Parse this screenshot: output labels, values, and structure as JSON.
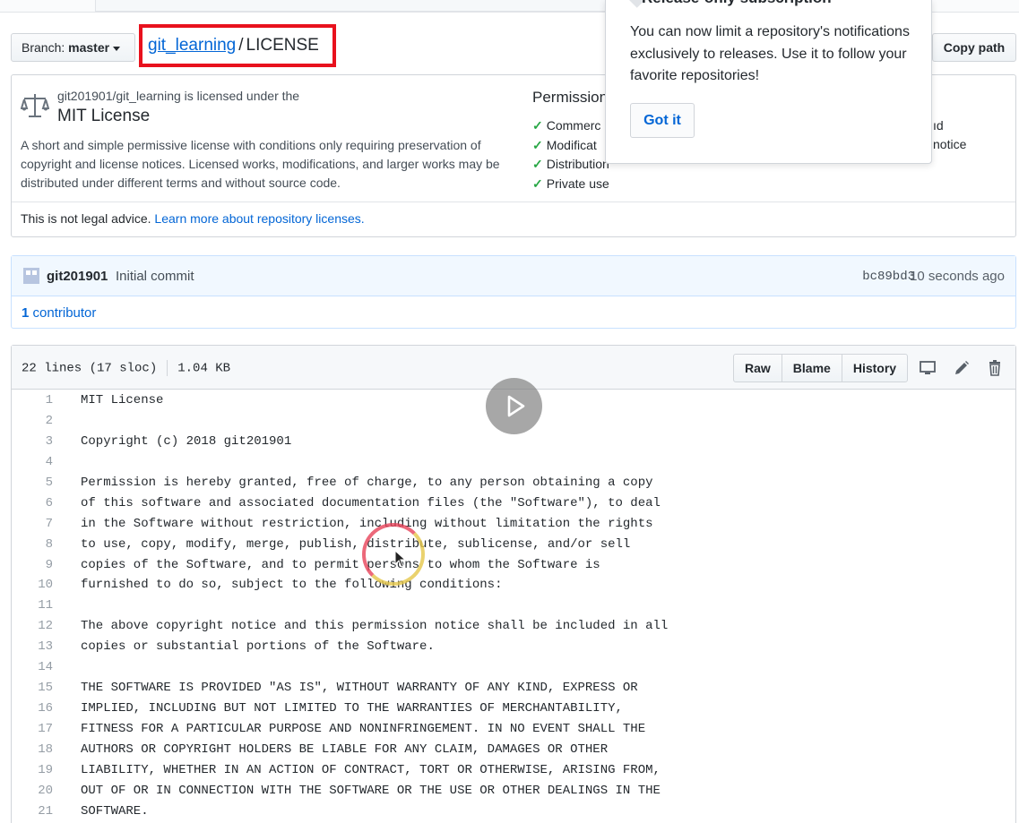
{
  "popover": {
    "title": "Release-only subscription",
    "body": "You can now limit a repository's notifications exclusively to releases. Use it to follow your favorite repositories!",
    "button": "Got it"
  },
  "branch": {
    "label": "Branch:",
    "value": "master"
  },
  "breadcrumb": {
    "repo": "git_learning",
    "separator": "/",
    "file": "LICENSE"
  },
  "copy_path": "Copy path",
  "license": {
    "owner_text": "git201901/git_learning is licensed under the",
    "name": "MIT License",
    "description": "A short and simple permissive license with conditions only requiring preservation of copyright and license notices. Licensed works, modifications, and larger works may be distributed under different terms and without source code.",
    "permissions_title": "Permission",
    "permissions": [
      "Commerc",
      "Modificat",
      "Distribution",
      "Private use"
    ],
    "frag_1": "ıd",
    "frag_2": "notice",
    "legal_text": "This is not legal advice.",
    "legal_link": "Learn more about repository licenses."
  },
  "commit": {
    "author": "git201901",
    "message": "Initial commit",
    "sha": "bc89bd3",
    "time": "10 seconds ago",
    "contributors_count": "1",
    "contributors_label": "contributor"
  },
  "file": {
    "lines_info": "22 lines (17 sloc)",
    "size": "1.04 KB",
    "buttons": {
      "raw": "Raw",
      "blame": "Blame",
      "history": "History"
    },
    "lines": [
      {
        "n": "1",
        "t": "MIT License"
      },
      {
        "n": "2",
        "t": ""
      },
      {
        "n": "3",
        "t": "Copyright (c) 2018 git201901"
      },
      {
        "n": "4",
        "t": ""
      },
      {
        "n": "5",
        "t": "Permission is hereby granted, free of charge, to any person obtaining a copy"
      },
      {
        "n": "6",
        "t": "of this software and associated documentation files (the \"Software\"), to deal"
      },
      {
        "n": "7",
        "t": "in the Software without restriction, including without limitation the rights"
      },
      {
        "n": "8",
        "t": "to use, copy, modify, merge, publish, distribute, sublicense, and/or sell"
      },
      {
        "n": "9",
        "t": "copies of the Software, and to permit persons to whom the Software is"
      },
      {
        "n": "10",
        "t": "furnished to do so, subject to the following conditions:"
      },
      {
        "n": "11",
        "t": ""
      },
      {
        "n": "12",
        "t": "The above copyright notice and this permission notice shall be included in all"
      },
      {
        "n": "13",
        "t": "copies or substantial portions of the Software."
      },
      {
        "n": "14",
        "t": ""
      },
      {
        "n": "15",
        "t": "THE SOFTWARE IS PROVIDED \"AS IS\", WITHOUT WARRANTY OF ANY KIND, EXPRESS OR"
      },
      {
        "n": "16",
        "t": "IMPLIED, INCLUDING BUT NOT LIMITED TO THE WARRANTIES OF MERCHANTABILITY,"
      },
      {
        "n": "17",
        "t": "FITNESS FOR A PARTICULAR PURPOSE AND NONINFRINGEMENT. IN NO EVENT SHALL THE"
      },
      {
        "n": "18",
        "t": "AUTHORS OR COPYRIGHT HOLDERS BE LIABLE FOR ANY CLAIM, DAMAGES OR OTHER"
      },
      {
        "n": "19",
        "t": "LIABILITY, WHETHER IN AN ACTION OF CONTRACT, TORT OR OTHERWISE, ARISING FROM,"
      },
      {
        "n": "20",
        "t": "OUT OF OR IN CONNECTION WITH THE SOFTWARE OR THE USE OR OTHER DEALINGS IN THE"
      },
      {
        "n": "21",
        "t": "SOFTWARE."
      }
    ]
  },
  "icons": {
    "scale": "scale-icon",
    "check": "check-icon",
    "desktop": "desktop-icon",
    "pencil": "pencil-icon",
    "trash": "trash-icon",
    "play": "play-icon",
    "cursor": "cursor-icon"
  },
  "colors": {
    "link": "#0366d6",
    "highlight_border": "#e8111d",
    "check": "#28a745",
    "commit_bg": "#f1f8ff"
  }
}
